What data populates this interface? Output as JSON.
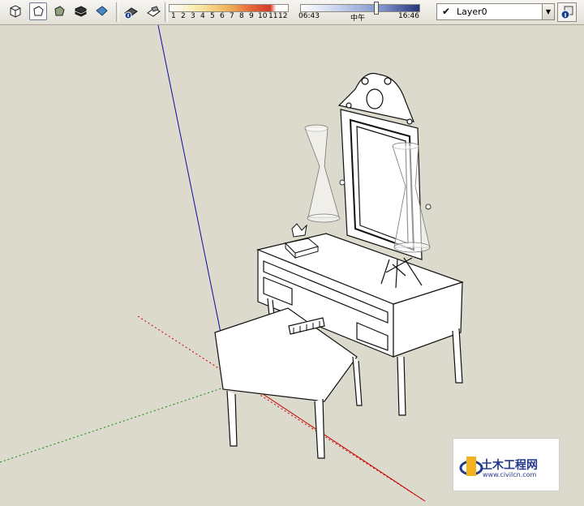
{
  "toolbar": {
    "month_ticks": [
      "1",
      "2",
      "3",
      "4",
      "5",
      "6",
      "7",
      "8",
      "9",
      "10",
      "11",
      "12"
    ],
    "time_start": "06:43",
    "time_noon": "中午",
    "time_end": "16:46",
    "time_value_fraction": 0.64,
    "layer": "Layer0",
    "icons": {
      "iso": "iso-view-icon",
      "wireframe": "wireframe-style-icon",
      "shaded": "shaded-style-icon",
      "shaded_textures": "shaded-textures-icon",
      "monochrome": "monochrome-style-icon",
      "shadow_settings": "shadow-settings-icon",
      "display_shadows": "display-shadows-icon",
      "layer_manager": "layer-manager-icon"
    }
  },
  "colors": {
    "background": "#dcdacc",
    "axis_blue": "#0a0aa8",
    "axis_red": "#c80000",
    "axis_green": "#0a8a0a",
    "brand": "#243a8c"
  },
  "watermark": {
    "title": "土木工程网",
    "url": "www.civilcn.com"
  }
}
